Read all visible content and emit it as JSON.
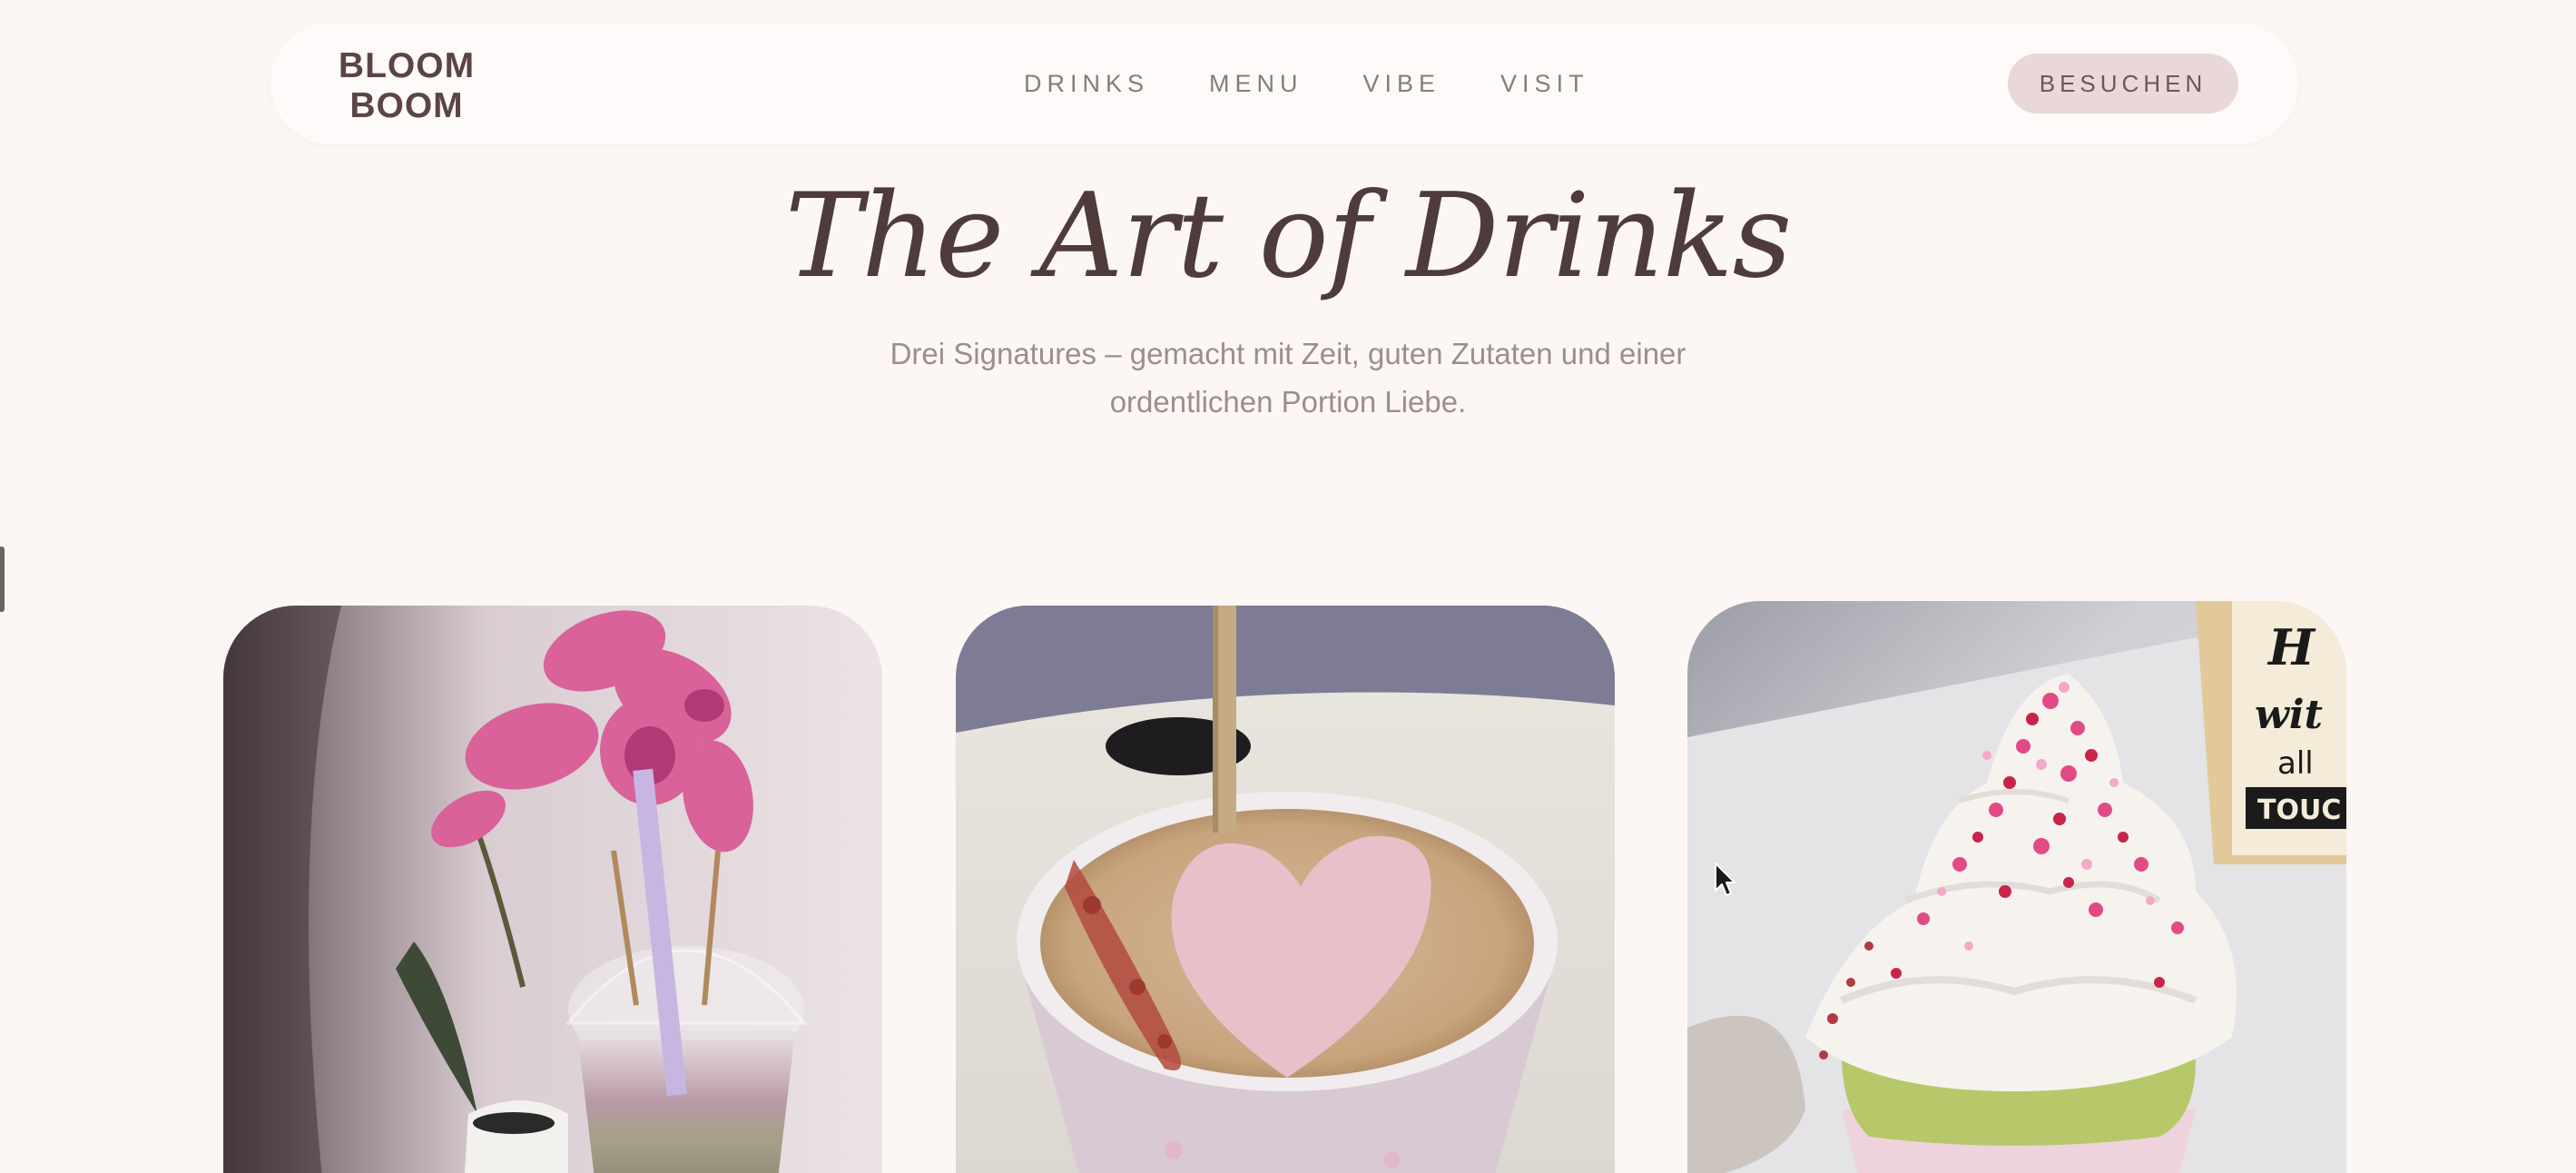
{
  "nav": {
    "logo_line1": "BLOOM",
    "logo_line2": "BOOM",
    "links": [
      {
        "label": "DRINKS"
      },
      {
        "label": "MENU"
      },
      {
        "label": "VIBE"
      },
      {
        "label": "VISIT"
      }
    ],
    "cta_label": "BESUCHEN"
  },
  "hero": {
    "title": "The Art of Drinks",
    "subtitle": "Drei Signatures – gemacht mit Zeit, guten Zutaten und einer ordentlichen Portion Liebe."
  },
  "cards": [
    {
      "image": "orchid-iced-drink-photo"
    },
    {
      "image": "heart-latte-photo"
    },
    {
      "image": "sprinkle-cream-cup-photo"
    }
  ],
  "colors": {
    "background": "#fcf7f5",
    "nav_bg": "#fdfaf9",
    "text_dark": "#4e3b3a",
    "text_muted": "#9b8e8c",
    "nav_link": "#8a7b79",
    "cta_bg": "#ead7d8"
  }
}
